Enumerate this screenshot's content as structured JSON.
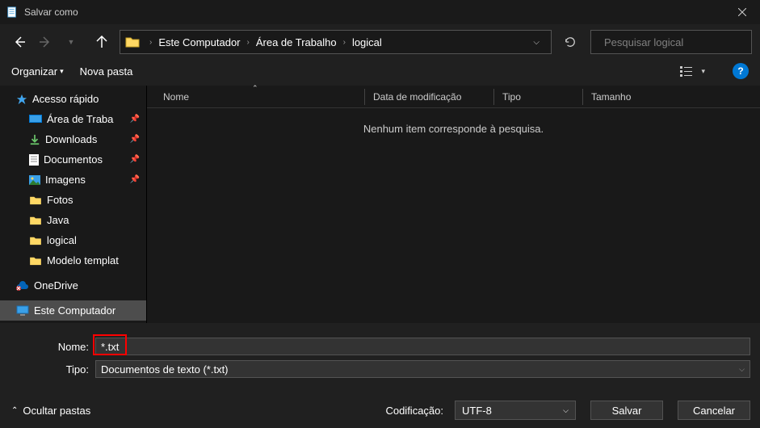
{
  "window": {
    "title": "Salvar como"
  },
  "nav": {
    "breadcrumb": [
      "Este Computador",
      "Área de Trabalho",
      "logical"
    ],
    "search_placeholder": "Pesquisar logical"
  },
  "toolbar": {
    "organize": "Organizar",
    "new_folder": "Nova pasta"
  },
  "sidebar": {
    "quick_access": "Acesso rápido",
    "items": [
      {
        "label": "Área de Traba",
        "pinned": true,
        "icon": "desktop"
      },
      {
        "label": "Downloads",
        "pinned": true,
        "icon": "downloads"
      },
      {
        "label": "Documentos",
        "pinned": true,
        "icon": "documents"
      },
      {
        "label": "Imagens",
        "pinned": true,
        "icon": "pictures"
      },
      {
        "label": "Fotos",
        "pinned": false,
        "icon": "folder"
      },
      {
        "label": "Java",
        "pinned": false,
        "icon": "folder"
      },
      {
        "label": "logical",
        "pinned": false,
        "icon": "folder"
      },
      {
        "label": "Modelo templat",
        "pinned": false,
        "icon": "folder"
      }
    ],
    "onedrive": "OneDrive",
    "this_pc": "Este Computador"
  },
  "columns": {
    "name": "Nome",
    "date": "Data de modificação",
    "type": "Tipo",
    "size": "Tamanho"
  },
  "content": {
    "empty_message": "Nenhum item corresponde à pesquisa."
  },
  "form": {
    "name_label": "Nome:",
    "name_value": "*.txt",
    "type_label": "Tipo:",
    "type_value": "Documentos de texto (*.txt)"
  },
  "footer": {
    "hide_folders": "Ocultar pastas",
    "encoding_label": "Codificação:",
    "encoding_value": "UTF-8",
    "save": "Salvar",
    "cancel": "Cancelar"
  }
}
